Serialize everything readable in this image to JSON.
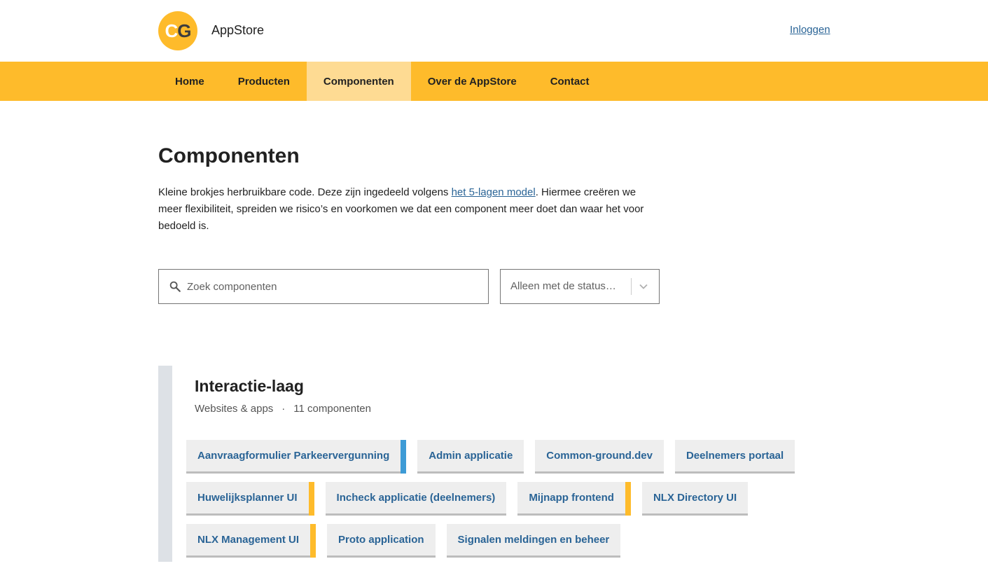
{
  "header": {
    "logo_text_c": "C",
    "logo_text_g": "G",
    "brand": "AppStore",
    "login_label": "Inloggen"
  },
  "nav": {
    "items": [
      {
        "label": "Home"
      },
      {
        "label": "Producten"
      },
      {
        "label": "Componenten",
        "active": true
      },
      {
        "label": "Over de AppStore"
      },
      {
        "label": "Contact"
      }
    ]
  },
  "main": {
    "title": "Componenten",
    "intro_before": "Kleine brokjes herbruikbare code. Deze zijn ingedeeld volgens ",
    "intro_link": "het 5-lagen model",
    "intro_after": ". Hiermee creëren we meer flexibiliteit, spreiden we risico’s en voorkomen we dat een component meer doet dan waar het voor bedoeld is.",
    "search": {
      "placeholder": "Zoek componenten",
      "icon": "search-icon"
    },
    "status_filter": {
      "placeholder": "Alleen met de status…",
      "icon": "chevron-down-icon"
    }
  },
  "layer": {
    "title": "Interactie-laag",
    "subtitle": "Websites & apps",
    "separator": "·",
    "count": "11 componenten",
    "colors": {
      "bar": "#dde1e6",
      "flag_blue": "#3d9bd6",
      "flag_yellow": "#febb2b"
    },
    "components": [
      {
        "label": "Aanvraagformulier Parkeervergunning",
        "flag": "blue"
      },
      {
        "label": "Admin applicatie",
        "flag": ""
      },
      {
        "label": "Common-ground.dev",
        "flag": ""
      },
      {
        "label": "Deelnemers portaal",
        "flag": ""
      },
      {
        "label": "Huwelijksplanner UI",
        "flag": "yellow"
      },
      {
        "label": "Incheck applicatie (deelnemers)",
        "flag": ""
      },
      {
        "label": "Mijnapp frontend",
        "flag": "yellow"
      },
      {
        "label": "NLX Directory UI",
        "flag": ""
      },
      {
        "label": "NLX Management UI",
        "flag": "yellow"
      },
      {
        "label": "Proto application",
        "flag": ""
      },
      {
        "label": "Signalen meldingen en beheer",
        "flag": ""
      }
    ]
  },
  "theme": {
    "accent": "#febb2b",
    "accent_active": "#fedb93",
    "link": "#2a6496"
  }
}
